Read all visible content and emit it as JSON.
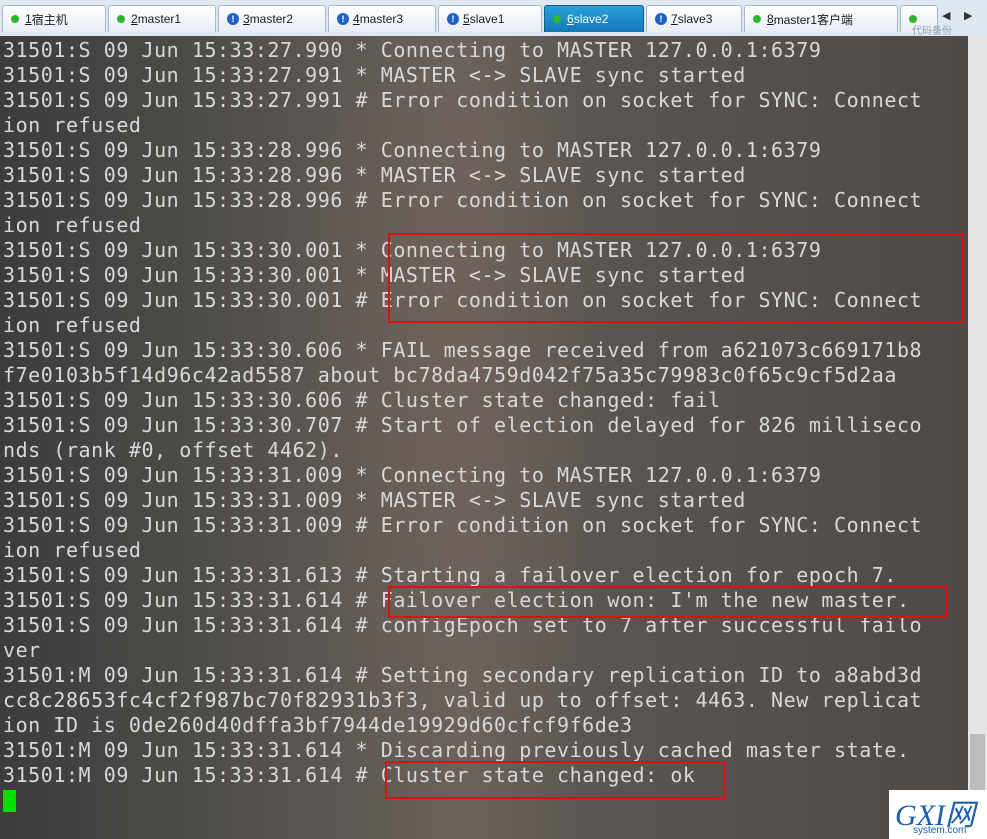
{
  "tabs": [
    {
      "num": "1",
      "label": "宿主机",
      "status": "green",
      "active": false
    },
    {
      "num": "2",
      "label": "master1",
      "status": "green",
      "active": false
    },
    {
      "num": "3",
      "label": "master2",
      "status": "warn",
      "active": false
    },
    {
      "num": "4",
      "label": "master3",
      "status": "warn",
      "active": false
    },
    {
      "num": "5",
      "label": "slave1",
      "status": "warn",
      "active": false
    },
    {
      "num": "6",
      "label": "slave2",
      "status": "green",
      "active": true
    },
    {
      "num": "7",
      "label": "slave3",
      "status": "warn",
      "active": false
    },
    {
      "num": "8",
      "label": "master1客户端",
      "status": "green",
      "active": false
    },
    {
      "num": "",
      "label": "",
      "status": "green",
      "active": false
    }
  ],
  "tab_nav": {
    "prev": "◀",
    "next": "▶"
  },
  "top_right_brand": "代码备份",
  "log_lines": [
    "31501:S 09 Jun 15:33:27.990 * Connecting to MASTER 127.0.0.1:6379",
    "31501:S 09 Jun 15:33:27.991 * MASTER <-> SLAVE sync started",
    "31501:S 09 Jun 15:33:27.991 # Error condition on socket for SYNC: Connect",
    "ion refused",
    "31501:S 09 Jun 15:33:28.996 * Connecting to MASTER 127.0.0.1:6379",
    "31501:S 09 Jun 15:33:28.996 * MASTER <-> SLAVE sync started",
    "31501:S 09 Jun 15:33:28.996 # Error condition on socket for SYNC: Connect",
    "ion refused",
    "31501:S 09 Jun 15:33:30.001 * Connecting to MASTER 127.0.0.1:6379",
    "31501:S 09 Jun 15:33:30.001 * MASTER <-> SLAVE sync started",
    "31501:S 09 Jun 15:33:30.001 # Error condition on socket for SYNC: Connect",
    "ion refused",
    "31501:S 09 Jun 15:33:30.606 * FAIL message received from a621073c669171b8",
    "f7e0103b5f14d96c42ad5587 about bc78da4759d042f75a35c79983c0f65c9cf5d2aa",
    "31501:S 09 Jun 15:33:30.606 # Cluster state changed: fail",
    "31501:S 09 Jun 15:33:30.707 # Start of election delayed for 826 millisecо",
    "nds (rank #0, offset 4462).",
    "31501:S 09 Jun 15:33:31.009 * Connecting to MASTER 127.0.0.1:6379",
    "31501:S 09 Jun 15:33:31.009 * MASTER <-> SLAVE sync started",
    "31501:S 09 Jun 15:33:31.009 # Error condition on socket for SYNC: Connect",
    "ion refused",
    "31501:S 09 Jun 15:33:31.613 # Starting a failover election for epoch 7.",
    "31501:S 09 Jun 15:33:31.614 # Failover election won: I'm the new master.",
    "31501:S 09 Jun 15:33:31.614 # configEpoch set to 7 after successful failo",
    "ver",
    "31501:M 09 Jun 15:33:31.614 # Setting secondary replication ID to a8abd3d",
    "cc8c28653fc4cf2f987bc70f82931b3f3, valid up to offset: 4463. New replicat",
    "ion ID is 0de260d40dffa3bf7944de19929d60cfcf9f6de3",
    "31501:M 09 Jun 15:33:31.614 * Discarding previously cached master state.",
    "31501:M 09 Jun 15:33:31.614 # Cluster state changed: ok"
  ],
  "watermark": {
    "main": "GXI网",
    "sub": "system.com"
  },
  "colors": {
    "highlight": "#e01010",
    "cursor": "#00e000",
    "active_tab": "#1a86c8"
  }
}
